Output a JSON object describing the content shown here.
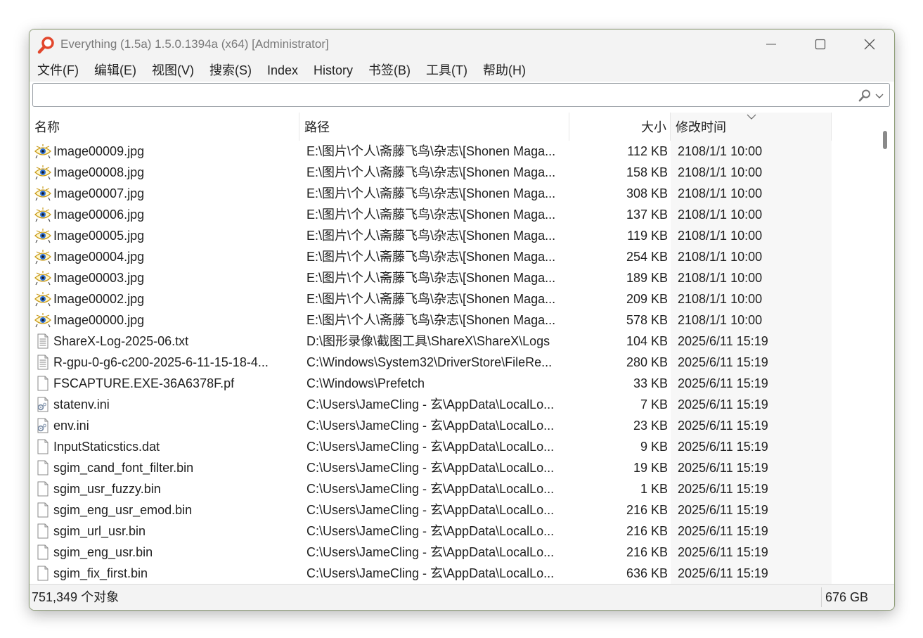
{
  "window": {
    "title": "Everything (1.5a) 1.5.0.1394a (x64) [Administrator]"
  },
  "menu": [
    {
      "id": "file",
      "label": "文件(F)"
    },
    {
      "id": "edit",
      "label": "编辑(E)"
    },
    {
      "id": "view",
      "label": "视图(V)"
    },
    {
      "id": "search",
      "label": "搜索(S)"
    },
    {
      "id": "index",
      "label": "Index"
    },
    {
      "id": "history",
      "label": "History"
    },
    {
      "id": "bookmarks",
      "label": "书签(B)"
    },
    {
      "id": "tools",
      "label": "工具(T)"
    },
    {
      "id": "help",
      "label": "帮助(H)"
    }
  ],
  "search": {
    "value": "",
    "placeholder": ""
  },
  "columns": {
    "name": "名称",
    "path": "路径",
    "size": "大小",
    "date": "修改时间"
  },
  "sort": {
    "column": "date",
    "direction": "descending"
  },
  "files": [
    {
      "icon": "image-file-icon",
      "name": "Image00009.jpg",
      "path": "E:\\图片\\个人\\斋藤飞鸟\\杂志\\[Shonen Maga...",
      "size": "112 KB",
      "date": "2108/1/1 10:00"
    },
    {
      "icon": "image-file-icon",
      "name": "Image00008.jpg",
      "path": "E:\\图片\\个人\\斋藤飞鸟\\杂志\\[Shonen Maga...",
      "size": "158 KB",
      "date": "2108/1/1 10:00"
    },
    {
      "icon": "image-file-icon",
      "name": "Image00007.jpg",
      "path": "E:\\图片\\个人\\斋藤飞鸟\\杂志\\[Shonen Maga...",
      "size": "308 KB",
      "date": "2108/1/1 10:00"
    },
    {
      "icon": "image-file-icon",
      "name": "Image00006.jpg",
      "path": "E:\\图片\\个人\\斋藤飞鸟\\杂志\\[Shonen Maga...",
      "size": "137 KB",
      "date": "2108/1/1 10:00"
    },
    {
      "icon": "image-file-icon",
      "name": "Image00005.jpg",
      "path": "E:\\图片\\个人\\斋藤飞鸟\\杂志\\[Shonen Maga...",
      "size": "119 KB",
      "date": "2108/1/1 10:00"
    },
    {
      "icon": "image-file-icon",
      "name": "Image00004.jpg",
      "path": "E:\\图片\\个人\\斋藤飞鸟\\杂志\\[Shonen Maga...",
      "size": "254 KB",
      "date": "2108/1/1 10:00"
    },
    {
      "icon": "image-file-icon",
      "name": "Image00003.jpg",
      "path": "E:\\图片\\个人\\斋藤飞鸟\\杂志\\[Shonen Maga...",
      "size": "189 KB",
      "date": "2108/1/1 10:00"
    },
    {
      "icon": "image-file-icon",
      "name": "Image00002.jpg",
      "path": "E:\\图片\\个人\\斋藤飞鸟\\杂志\\[Shonen Maga...",
      "size": "209 KB",
      "date": "2108/1/1 10:00"
    },
    {
      "icon": "image-file-icon",
      "name": "Image00000.jpg",
      "path": "E:\\图片\\个人\\斋藤飞鸟\\杂志\\[Shonen Maga...",
      "size": "578 KB",
      "date": "2108/1/1 10:00"
    },
    {
      "icon": "text-file-icon",
      "name": "ShareX-Log-2025-06.txt",
      "path": "D:\\图形录像\\截图工具\\ShareX\\ShareX\\Logs",
      "size": "104 KB",
      "date": "2025/6/11 15:19"
    },
    {
      "icon": "text-file-icon",
      "name": "R-gpu-0-g6-c200-2025-6-11-15-18-4...",
      "path": "C:\\Windows\\System32\\DriverStore\\FileRe...",
      "size": "280 KB",
      "date": "2025/6/11 15:19"
    },
    {
      "icon": "blank-file-icon",
      "name": "FSCAPTURE.EXE-36A6378F.pf",
      "path": "C:\\Windows\\Prefetch",
      "size": "33 KB",
      "date": "2025/6/11 15:19"
    },
    {
      "icon": "config-file-icon",
      "name": "statenv.ini",
      "path": "C:\\Users\\JameCling - 玄\\AppData\\LocalLo...",
      "size": "7 KB",
      "date": "2025/6/11 15:19"
    },
    {
      "icon": "config-file-icon",
      "name": "env.ini",
      "path": "C:\\Users\\JameCling - 玄\\AppData\\LocalLo...",
      "size": "23 KB",
      "date": "2025/6/11 15:19"
    },
    {
      "icon": "blank-file-icon",
      "name": "InputStaticstics.dat",
      "path": "C:\\Users\\JameCling - 玄\\AppData\\LocalLo...",
      "size": "9 KB",
      "date": "2025/6/11 15:19"
    },
    {
      "icon": "blank-file-icon",
      "name": "sgim_cand_font_filter.bin",
      "path": "C:\\Users\\JameCling - 玄\\AppData\\LocalLo...",
      "size": "19 KB",
      "date": "2025/6/11 15:19"
    },
    {
      "icon": "blank-file-icon",
      "name": "sgim_usr_fuzzy.bin",
      "path": "C:\\Users\\JameCling - 玄\\AppData\\LocalLo...",
      "size": "1 KB",
      "date": "2025/6/11 15:19"
    },
    {
      "icon": "blank-file-icon",
      "name": "sgim_eng_usr_emod.bin",
      "path": "C:\\Users\\JameCling - 玄\\AppData\\LocalLo...",
      "size": "216 KB",
      "date": "2025/6/11 15:19"
    },
    {
      "icon": "blank-file-icon",
      "name": "sgim_url_usr.bin",
      "path": "C:\\Users\\JameCling - 玄\\AppData\\LocalLo...",
      "size": "216 KB",
      "date": "2025/6/11 15:19"
    },
    {
      "icon": "blank-file-icon",
      "name": "sgim_eng_usr.bin",
      "path": "C:\\Users\\JameCling - 玄\\AppData\\LocalLo...",
      "size": "216 KB",
      "date": "2025/6/11 15:19"
    },
    {
      "icon": "blank-file-icon",
      "name": "sgim_fix_first.bin",
      "path": "C:\\Users\\JameCling - 玄\\AppData\\LocalLo...",
      "size": "636 KB",
      "date": "2025/6/11 15:19"
    }
  ],
  "status": {
    "object_count": "751,349 个对象",
    "total_size": "676 GB"
  },
  "colors": {
    "accent_icon": "#e2462c",
    "window_border": "#8f9e79",
    "chrome_bg": "#f3f3f3"
  }
}
